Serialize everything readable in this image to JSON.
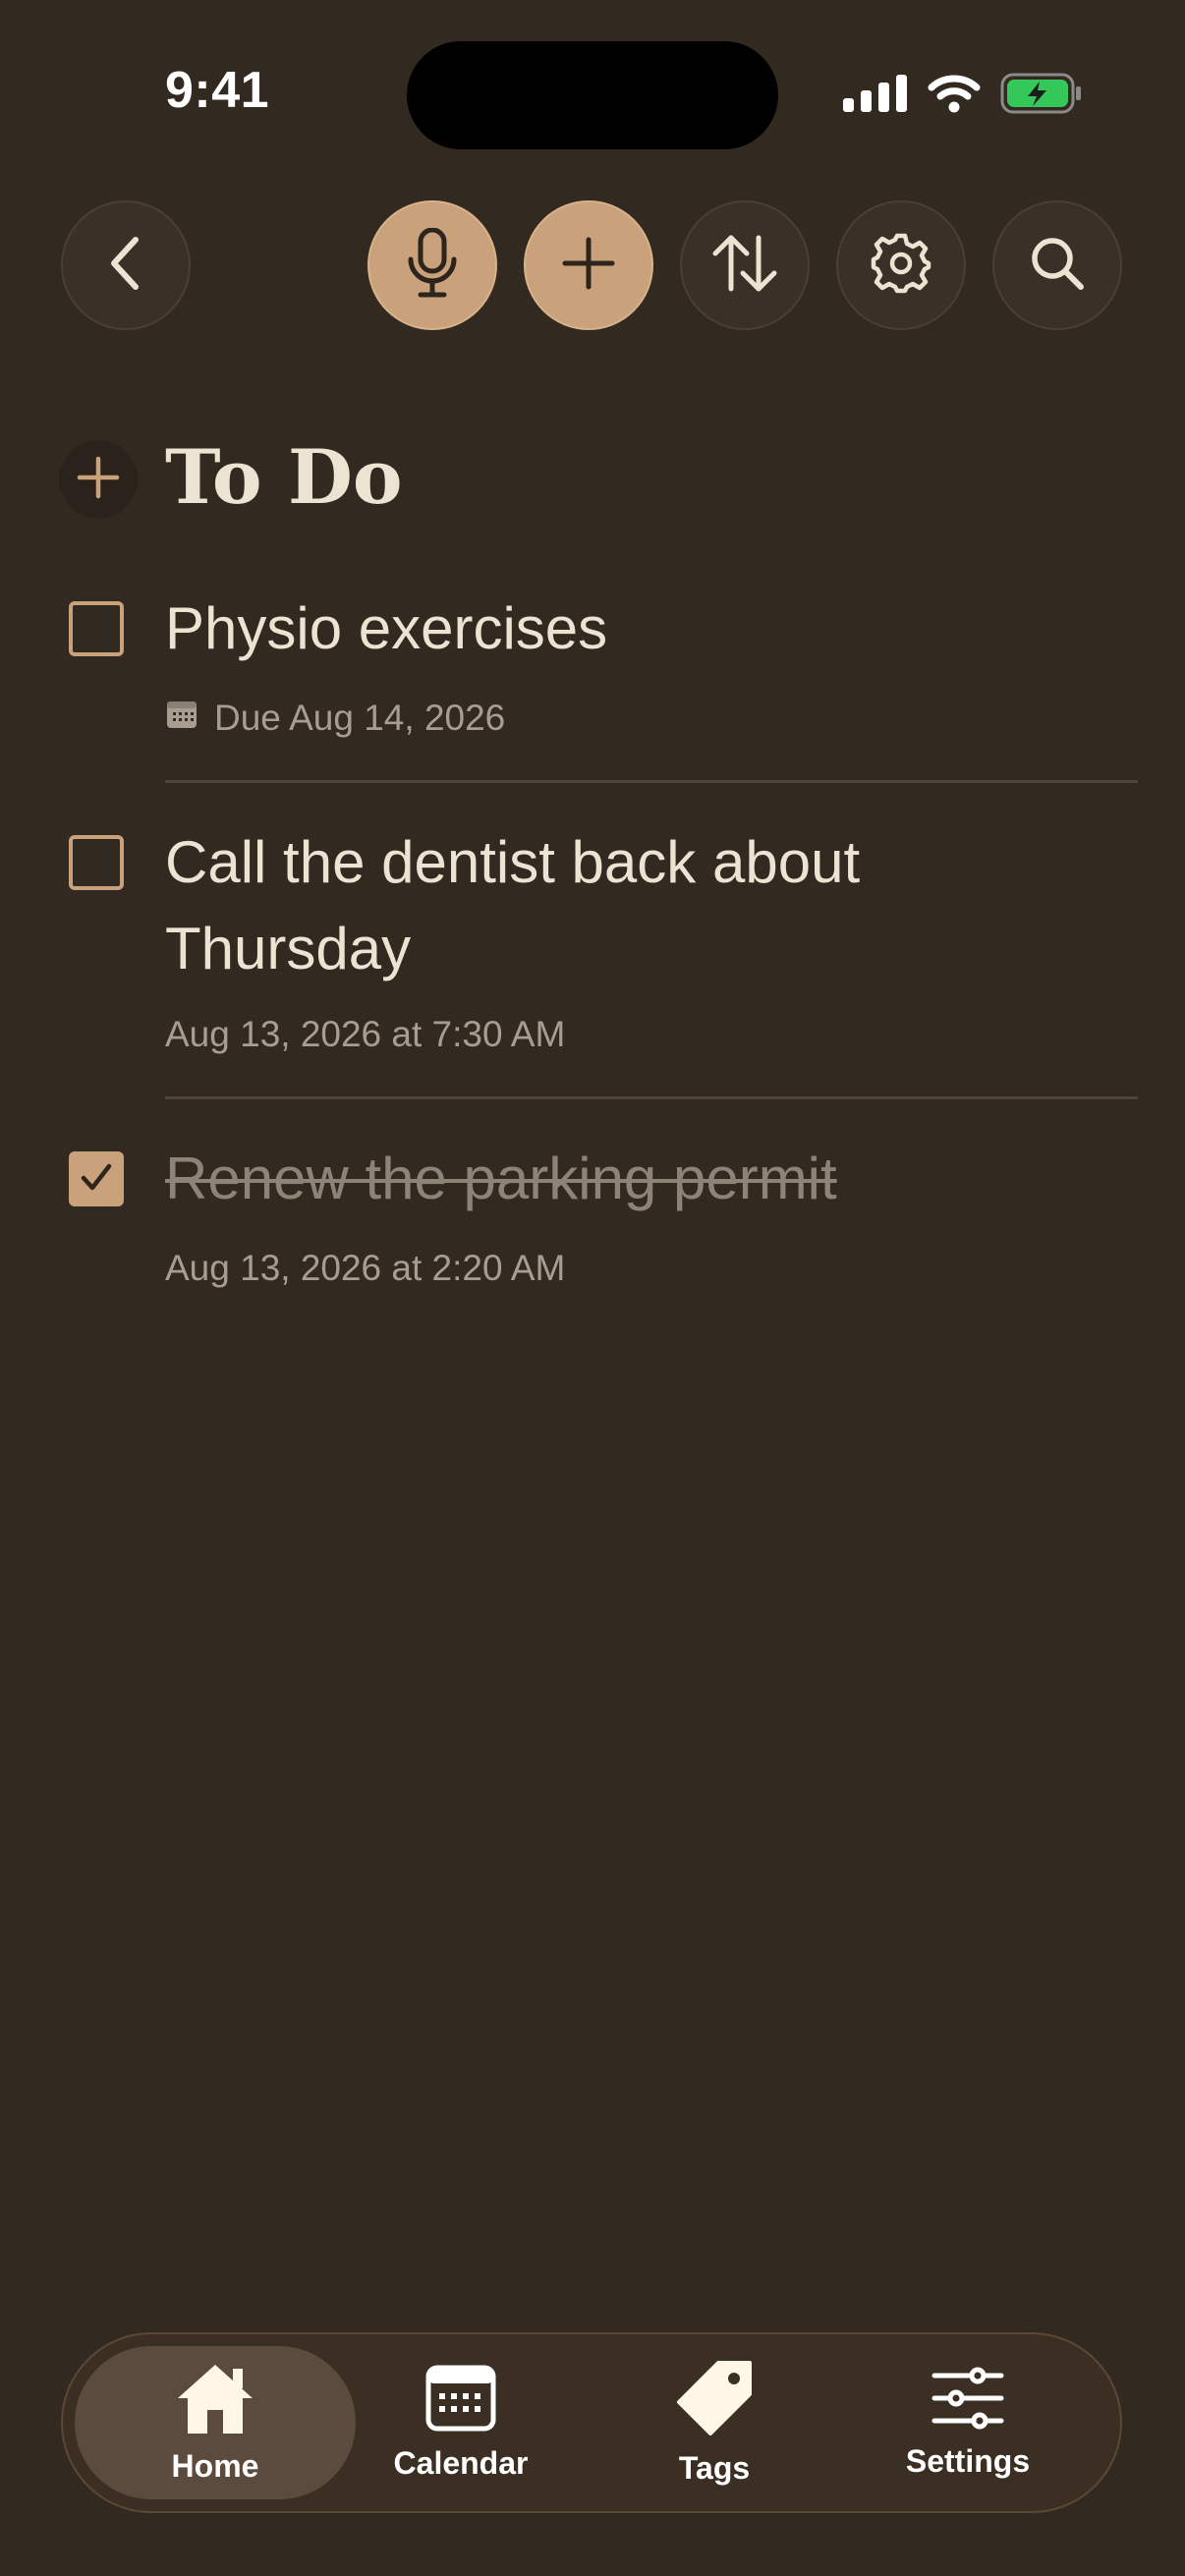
{
  "status_bar": {
    "time": "9:41"
  },
  "toolbar": {
    "back_icon": "chevron-left-icon",
    "mic_icon": "microphone-icon",
    "add_icon": "plus-icon",
    "sort_icon": "sort-arrows-icon",
    "settings_icon": "gear-icon",
    "search_icon": "search-icon"
  },
  "section": {
    "title": "To Do"
  },
  "tasks": [
    {
      "title": "Physio exercises",
      "meta": "Due Aug 14, 2026",
      "checked": false,
      "has_calendar_icon": true
    },
    {
      "title": "Call the dentist back about Thursday",
      "meta": "Aug 13, 2026 at 7:30 AM",
      "checked": false,
      "has_calendar_icon": false
    },
    {
      "title": "Renew the parking permit",
      "meta": "Aug 13, 2026 at 2:20 AM",
      "checked": true,
      "has_calendar_icon": false
    }
  ],
  "tabbar": {
    "tabs": [
      {
        "label": "Home",
        "icon": "home-icon",
        "active": true
      },
      {
        "label": "Calendar",
        "icon": "calendar-icon",
        "active": false
      },
      {
        "label": "Tags",
        "icon": "tag-icon",
        "active": false
      },
      {
        "label": "Settings",
        "icon": "sliders-icon",
        "active": false
      }
    ]
  },
  "colors": {
    "background": "#322920",
    "accent": "#c9a27b",
    "text_primary": "#ece3d3",
    "text_secondary": "#a89d90",
    "battery_green": "#34c759"
  }
}
